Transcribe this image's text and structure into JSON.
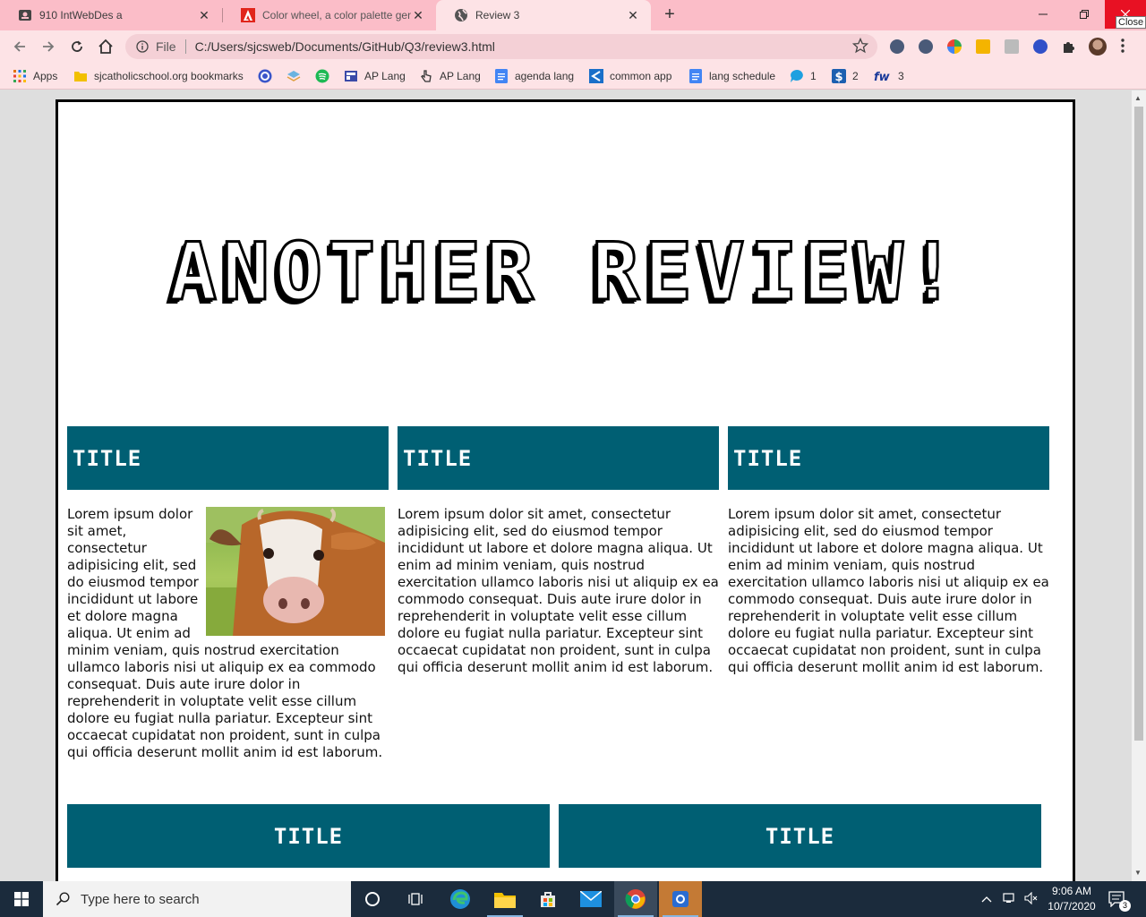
{
  "browser": {
    "tabs": [
      {
        "title": "910 IntWebDes a",
        "active": false
      },
      {
        "title": "Color wheel, a color palette gene",
        "active": false
      },
      {
        "title": "Review 3",
        "active": true
      }
    ],
    "new_tab_symbol": "+",
    "close_tooltip": "Close",
    "address": {
      "scheme_label": "File",
      "url": "C:/Users/sjcsweb/Documents/GitHub/Q3/review3.html"
    },
    "bookmarks": [
      {
        "label": "Apps",
        "icon": "apps-grid-icon"
      },
      {
        "label": "sjcatholicschool.org bookmarks",
        "icon": "folder-icon"
      },
      {
        "label": "",
        "icon": "quizlet-icon"
      },
      {
        "label": "",
        "icon": "layers-icon"
      },
      {
        "label": "",
        "icon": "spotify-icon"
      },
      {
        "label": "AP Lang",
        "icon": "classroom-icon"
      },
      {
        "label": "AP Lang",
        "icon": "pointer-icon"
      },
      {
        "label": "agenda lang",
        "icon": "docs-icon"
      },
      {
        "label": "common app",
        "icon": "commonapp-icon"
      },
      {
        "label": "lang schedule",
        "icon": "docs-icon"
      },
      {
        "label": "1",
        "icon": "chat-icon"
      },
      {
        "label": "2",
        "icon": "dollar-icon"
      },
      {
        "label": "3",
        "icon": "fw-icon"
      }
    ],
    "colors": {
      "frame": "#fbbdc8",
      "toolbar": "#fde3e6",
      "accent": "#005f73"
    }
  },
  "page": {
    "hero_title": "ANOTHER REVIEW!",
    "columns": [
      {
        "title": "TITLE",
        "has_image": true,
        "image_alt": "cow",
        "text": "Lorem ipsum dolor sit amet, consectetur adipisicing elit, sed do eiusmod tempor incididunt ut labore et dolore magna aliqua. Ut enim ad minim veniam, quis nostrud exercitation ullamco laboris nisi ut aliquip ex ea commodo consequat. Duis aute irure dolor in reprehenderit in voluptate velit esse cillum dolore eu fugiat nulla pariatur. Excepteur sint occaecat cupidatat non proident, sunt in culpa qui officia deserunt mollit anim id est laborum."
      },
      {
        "title": "TITLE",
        "has_image": false,
        "text": "Lorem ipsum dolor sit amet, consectetur adipisicing elit, sed do eiusmod tempor incididunt ut labore et dolore magna aliqua. Ut enim ad minim veniam, quis nostrud exercitation ullamco laboris nisi ut aliquip ex ea commodo consequat. Duis aute irure dolor in reprehenderit in voluptate velit esse cillum dolore eu fugiat nulla pariatur. Excepteur sint occaecat cupidatat non proident, sunt in culpa qui officia deserunt mollit anim id est laborum."
      },
      {
        "title": "TITLE",
        "has_image": false,
        "text": "Lorem ipsum dolor sit amet, consectetur adipisicing elit, sed do eiusmod tempor incididunt ut labore et dolore magna aliqua. Ut enim ad minim veniam, quis nostrud exercitation ullamco laboris nisi ut aliquip ex ea commodo consequat. Duis aute irure dolor in reprehenderit in voluptate velit esse cillum dolore eu fugiat nulla pariatur. Excepteur sint occaecat cupidatat non proident, sunt in culpa qui officia deserunt mollit anim id est laborum."
      }
    ],
    "bottom_boxes": [
      {
        "title": "TITLE"
      },
      {
        "title": "TITLE"
      }
    ]
  },
  "taskbar": {
    "search_placeholder": "Type here to search",
    "time": "9:06 AM",
    "date": "10/7/2020",
    "notification_count": "3"
  }
}
